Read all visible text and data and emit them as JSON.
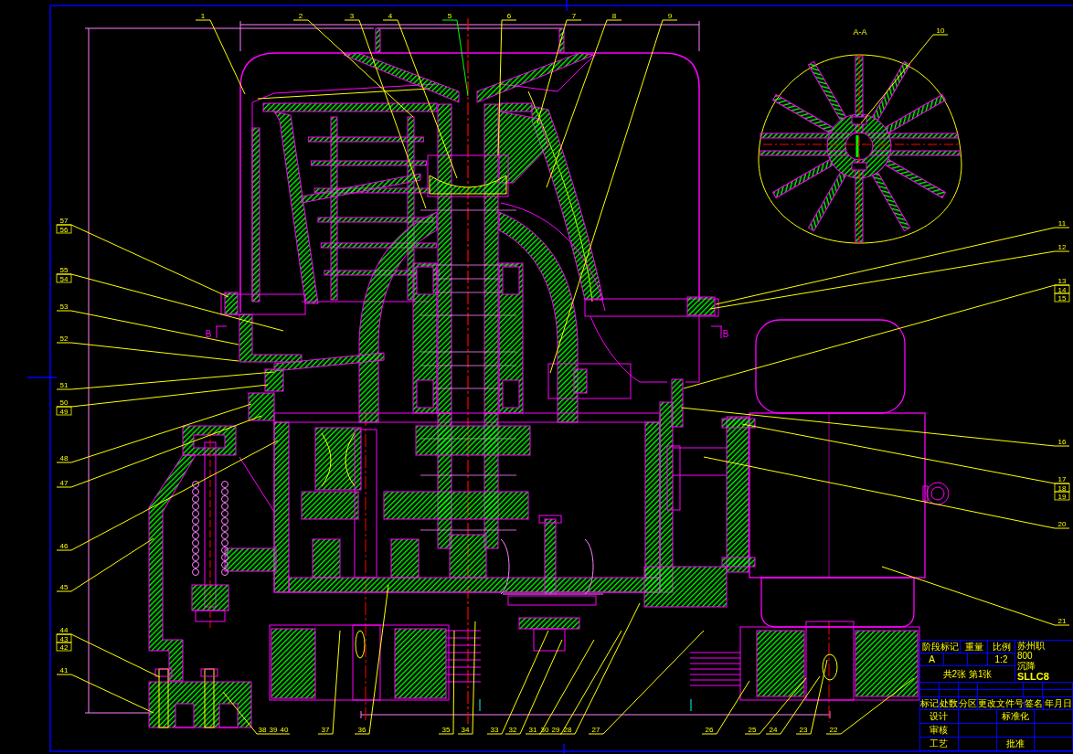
{
  "section_view": {
    "title": "A-A"
  },
  "section_marks": [
    {
      "label": "B"
    },
    {
      "label": "B"
    }
  ],
  "balloons_top": [
    {
      "labels": [
        "1"
      ]
    },
    {
      "labels": [
        "2"
      ]
    },
    {
      "labels": [
        "3"
      ]
    },
    {
      "labels": [
        "4"
      ]
    },
    {
      "labels": [
        "5"
      ]
    },
    {
      "labels": [
        "6"
      ]
    },
    {
      "labels": [
        "7"
      ]
    },
    {
      "labels": [
        "8"
      ]
    },
    {
      "labels": [
        "9"
      ]
    },
    {
      "labels": [
        "10"
      ]
    }
  ],
  "balloons_right": [
    {
      "labels": [
        "11"
      ]
    },
    {
      "labels": [
        "12"
      ]
    },
    {
      "labels": [
        "13",
        "14",
        "15"
      ]
    },
    {
      "labels": [
        "16"
      ]
    },
    {
      "labels": [
        "17",
        "18",
        "19"
      ]
    },
    {
      "labels": [
        "20"
      ]
    },
    {
      "labels": [
        "21"
      ]
    }
  ],
  "balloons_bottom": [
    {
      "labels": [
        "38",
        "39",
        "40"
      ]
    },
    {
      "labels": [
        "37"
      ]
    },
    {
      "labels": [
        "36"
      ]
    },
    {
      "labels": [
        "35"
      ]
    },
    {
      "labels": [
        "34"
      ]
    },
    {
      "labels": [
        "33"
      ]
    },
    {
      "labels": [
        "32"
      ]
    },
    {
      "labels": [
        "31"
      ]
    },
    {
      "labels": [
        "30",
        "29"
      ]
    },
    {
      "labels": [
        "28"
      ]
    },
    {
      "labels": [
        "27"
      ]
    },
    {
      "labels": [
        "26"
      ]
    },
    {
      "labels": [
        "25"
      ]
    },
    {
      "labels": [
        "24"
      ]
    },
    {
      "labels": [
        "23"
      ]
    },
    {
      "labels": [
        "22"
      ]
    }
  ],
  "balloons_left": [
    {
      "labels": [
        "57",
        "56"
      ]
    },
    {
      "labels": [
        "55",
        "54"
      ]
    },
    {
      "labels": [
        "53"
      ]
    },
    {
      "labels": [
        "52"
      ]
    },
    {
      "labels": [
        "51"
      ]
    },
    {
      "labels": [
        "50",
        "49"
      ]
    },
    {
      "labels": [
        "48"
      ]
    },
    {
      "labels": [
        "47"
      ]
    },
    {
      "labels": [
        "46"
      ]
    },
    {
      "labels": [
        "45"
      ]
    },
    {
      "labels": [
        "44",
        "43",
        "42"
      ]
    },
    {
      "labels": [
        "41"
      ]
    }
  ],
  "title_block": {
    "stage_headers": [
      "阶段标记",
      "重量",
      "比例"
    ],
    "stage": "A",
    "scale": "1:2",
    "sheet_count": "共2张 第1张",
    "organization": "苏州职",
    "title_lines": [
      "800",
      "沉降"
    ],
    "drawing_number": "SLLC8",
    "revision_headers": [
      "标记",
      "处数",
      "分区",
      "更改文件号",
      "签名",
      "年月日"
    ],
    "sign_rows": [
      [
        "设计",
        "标准化"
      ],
      [
        "审核"
      ],
      [
        "工艺",
        "批准"
      ]
    ]
  }
}
